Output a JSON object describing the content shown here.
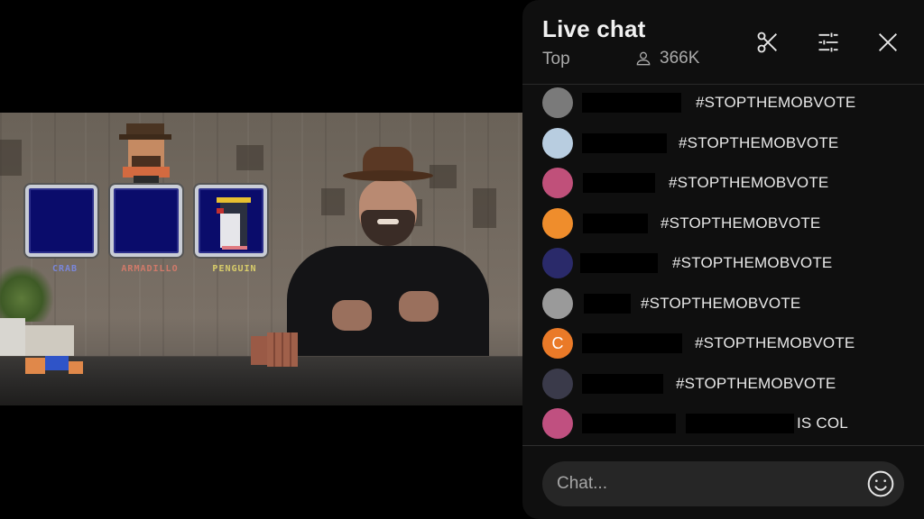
{
  "video": {
    "slots": [
      {
        "label": "CRAB",
        "label_color": "#7a86d8",
        "filled": false
      },
      {
        "label": "ARMADILLO",
        "label_color": "#d07a6a",
        "filled": false
      },
      {
        "label": "PENGUIN",
        "label_color": "#d8cc6a",
        "filled": true
      }
    ]
  },
  "chat": {
    "title": "Live chat",
    "mode": "Top",
    "viewer_count": "366K",
    "icons": {
      "clip": "scissors-icon",
      "settings": "sliders-icon",
      "close": "close-icon",
      "viewers": "person-icon",
      "emoji": "smiley-icon"
    },
    "messages": [
      {
        "avatar": "gray-cat",
        "avatar_bg": "#7a7a7a",
        "text": "#STOPTHEMOBVOTE"
      },
      {
        "avatar": "blue-sky",
        "avatar_bg": "#b8cde0",
        "text": "#STOPTHEMOBVOTE"
      },
      {
        "avatar": "pink-character",
        "avatar_bg": "#c0507a",
        "text": "#STOPTHEMOBVOTE"
      },
      {
        "avatar": "panda-orange",
        "avatar_bg": "#ef8d2c",
        "text": "#STOPTHEMOBVOTE"
      },
      {
        "avatar": "purple-night",
        "avatar_bg": "#2a2a6a",
        "text": "#STOPTHEMOBVOTE"
      },
      {
        "avatar": "gray-abstract",
        "avatar_bg": "#9a9a9a",
        "text": "#STOPTHEMOBVOTE"
      },
      {
        "avatar": "letter-c",
        "avatar_bg": "#ea7a28",
        "avatar_letter": "C",
        "text": "#STOPTHEMOBVOTE"
      },
      {
        "avatar": "dark-figure",
        "avatar_bg": "#3a3a4a",
        "text": "#STOPTHEMOBVOTE"
      },
      {
        "avatar": "colorful-gorilla",
        "avatar_bg": "#c05080",
        "text": "IS COL"
      }
    ],
    "input": {
      "placeholder": "Chat...",
      "value": ""
    }
  }
}
